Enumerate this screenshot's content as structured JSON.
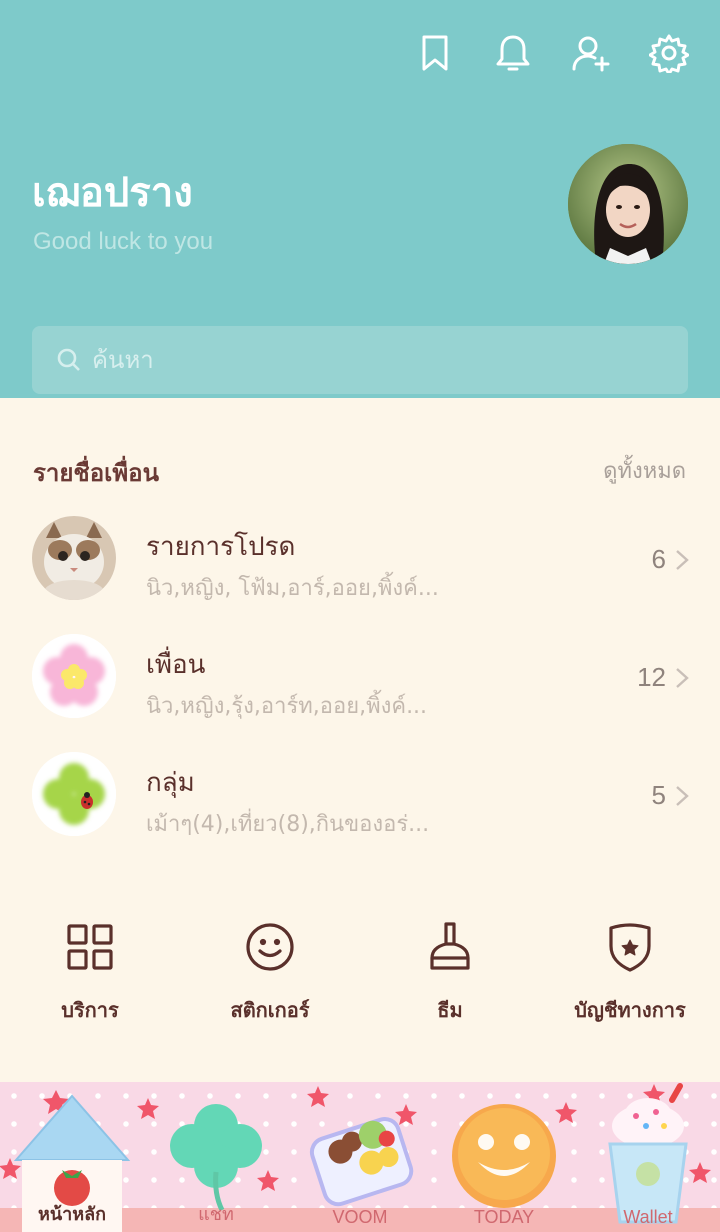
{
  "header": {
    "icons": [
      "bookmark-icon",
      "bell-icon",
      "add-friend-icon",
      "gear-icon"
    ],
    "bg_color": "#7ecaca"
  },
  "profile": {
    "name": "เฌอปราง",
    "status": "Good luck to you"
  },
  "search": {
    "placeholder": "ค้นหา"
  },
  "friends_section": {
    "title": "รายชื่อเพื่อน",
    "see_all": "ดูทั้งหมด",
    "rows": [
      {
        "title": "รายการโปรด",
        "subtitle": "นิว,หญิง, โฟ้ม,อาร์,ออย,พิ้งค์...",
        "count": "6"
      },
      {
        "title": "เพื่อน",
        "subtitle": "นิว,หญิง,รุ้ง,อาร์ท,ออย,พิ้งค์...",
        "count": "12"
      },
      {
        "title": "กลุ่ม",
        "subtitle": "เม้าๆ(4),เที่ยว(8),กินของอร่...",
        "count": "5"
      }
    ]
  },
  "shortcuts": [
    {
      "label": "บริการ",
      "icon": "grid-icon"
    },
    {
      "label": "สติกเกอร์",
      "icon": "smiley-icon"
    },
    {
      "label": "ธีม",
      "icon": "brush-icon"
    },
    {
      "label": "บัญชีทางการ",
      "icon": "shield-star-icon"
    }
  ],
  "tabs": [
    {
      "label": "หน้าหลัก",
      "icon": "house-icon",
      "active": true
    },
    {
      "label": "แชท",
      "icon": "clover-icon",
      "active": false
    },
    {
      "label": "VOOM",
      "icon": "bento-icon",
      "active": false
    },
    {
      "label": "TODAY",
      "icon": "smile-cookie-icon",
      "active": false
    },
    {
      "label": "Wallet",
      "icon": "drink-icon",
      "active": false
    }
  ],
  "colors": {
    "accent": "#7ecaca",
    "text_dark": "#5a302b",
    "bg_cream": "#fdf6e9",
    "tabbar_pink": "#f9d9e6"
  }
}
